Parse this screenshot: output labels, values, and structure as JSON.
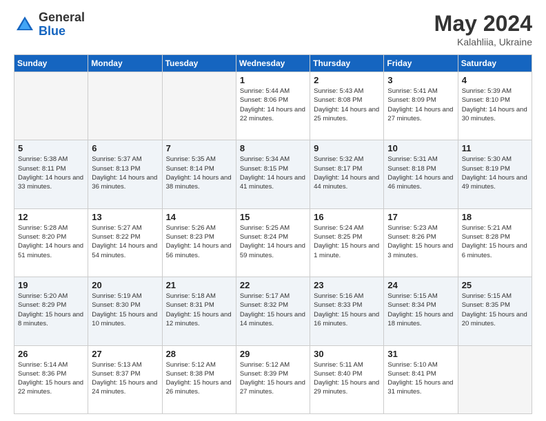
{
  "logo": {
    "general": "General",
    "blue": "Blue"
  },
  "title": {
    "month_year": "May 2024",
    "location": "Kalahliia, Ukraine"
  },
  "days_of_week": [
    "Sunday",
    "Monday",
    "Tuesday",
    "Wednesday",
    "Thursday",
    "Friday",
    "Saturday"
  ],
  "weeks": [
    [
      {
        "day": "",
        "sunrise": "",
        "sunset": "",
        "daylight": ""
      },
      {
        "day": "",
        "sunrise": "",
        "sunset": "",
        "daylight": ""
      },
      {
        "day": "",
        "sunrise": "",
        "sunset": "",
        "daylight": ""
      },
      {
        "day": "1",
        "sunrise": "Sunrise: 5:44 AM",
        "sunset": "Sunset: 8:06 PM",
        "daylight": "Daylight: 14 hours and 22 minutes."
      },
      {
        "day": "2",
        "sunrise": "Sunrise: 5:43 AM",
        "sunset": "Sunset: 8:08 PM",
        "daylight": "Daylight: 14 hours and 25 minutes."
      },
      {
        "day": "3",
        "sunrise": "Sunrise: 5:41 AM",
        "sunset": "Sunset: 8:09 PM",
        "daylight": "Daylight: 14 hours and 27 minutes."
      },
      {
        "day": "4",
        "sunrise": "Sunrise: 5:39 AM",
        "sunset": "Sunset: 8:10 PM",
        "daylight": "Daylight: 14 hours and 30 minutes."
      }
    ],
    [
      {
        "day": "5",
        "sunrise": "Sunrise: 5:38 AM",
        "sunset": "Sunset: 8:11 PM",
        "daylight": "Daylight: 14 hours and 33 minutes."
      },
      {
        "day": "6",
        "sunrise": "Sunrise: 5:37 AM",
        "sunset": "Sunset: 8:13 PM",
        "daylight": "Daylight: 14 hours and 36 minutes."
      },
      {
        "day": "7",
        "sunrise": "Sunrise: 5:35 AM",
        "sunset": "Sunset: 8:14 PM",
        "daylight": "Daylight: 14 hours and 38 minutes."
      },
      {
        "day": "8",
        "sunrise": "Sunrise: 5:34 AM",
        "sunset": "Sunset: 8:15 PM",
        "daylight": "Daylight: 14 hours and 41 minutes."
      },
      {
        "day": "9",
        "sunrise": "Sunrise: 5:32 AM",
        "sunset": "Sunset: 8:17 PM",
        "daylight": "Daylight: 14 hours and 44 minutes."
      },
      {
        "day": "10",
        "sunrise": "Sunrise: 5:31 AM",
        "sunset": "Sunset: 8:18 PM",
        "daylight": "Daylight: 14 hours and 46 minutes."
      },
      {
        "day": "11",
        "sunrise": "Sunrise: 5:30 AM",
        "sunset": "Sunset: 8:19 PM",
        "daylight": "Daylight: 14 hours and 49 minutes."
      }
    ],
    [
      {
        "day": "12",
        "sunrise": "Sunrise: 5:28 AM",
        "sunset": "Sunset: 8:20 PM",
        "daylight": "Daylight: 14 hours and 51 minutes."
      },
      {
        "day": "13",
        "sunrise": "Sunrise: 5:27 AM",
        "sunset": "Sunset: 8:22 PM",
        "daylight": "Daylight: 14 hours and 54 minutes."
      },
      {
        "day": "14",
        "sunrise": "Sunrise: 5:26 AM",
        "sunset": "Sunset: 8:23 PM",
        "daylight": "Daylight: 14 hours and 56 minutes."
      },
      {
        "day": "15",
        "sunrise": "Sunrise: 5:25 AM",
        "sunset": "Sunset: 8:24 PM",
        "daylight": "Daylight: 14 hours and 59 minutes."
      },
      {
        "day": "16",
        "sunrise": "Sunrise: 5:24 AM",
        "sunset": "Sunset: 8:25 PM",
        "daylight": "Daylight: 15 hours and 1 minute."
      },
      {
        "day": "17",
        "sunrise": "Sunrise: 5:23 AM",
        "sunset": "Sunset: 8:26 PM",
        "daylight": "Daylight: 15 hours and 3 minutes."
      },
      {
        "day": "18",
        "sunrise": "Sunrise: 5:21 AM",
        "sunset": "Sunset: 8:28 PM",
        "daylight": "Daylight: 15 hours and 6 minutes."
      }
    ],
    [
      {
        "day": "19",
        "sunrise": "Sunrise: 5:20 AM",
        "sunset": "Sunset: 8:29 PM",
        "daylight": "Daylight: 15 hours and 8 minutes."
      },
      {
        "day": "20",
        "sunrise": "Sunrise: 5:19 AM",
        "sunset": "Sunset: 8:30 PM",
        "daylight": "Daylight: 15 hours and 10 minutes."
      },
      {
        "day": "21",
        "sunrise": "Sunrise: 5:18 AM",
        "sunset": "Sunset: 8:31 PM",
        "daylight": "Daylight: 15 hours and 12 minutes."
      },
      {
        "day": "22",
        "sunrise": "Sunrise: 5:17 AM",
        "sunset": "Sunset: 8:32 PM",
        "daylight": "Daylight: 15 hours and 14 minutes."
      },
      {
        "day": "23",
        "sunrise": "Sunrise: 5:16 AM",
        "sunset": "Sunset: 8:33 PM",
        "daylight": "Daylight: 15 hours and 16 minutes."
      },
      {
        "day": "24",
        "sunrise": "Sunrise: 5:15 AM",
        "sunset": "Sunset: 8:34 PM",
        "daylight": "Daylight: 15 hours and 18 minutes."
      },
      {
        "day": "25",
        "sunrise": "Sunrise: 5:15 AM",
        "sunset": "Sunset: 8:35 PM",
        "daylight": "Daylight: 15 hours and 20 minutes."
      }
    ],
    [
      {
        "day": "26",
        "sunrise": "Sunrise: 5:14 AM",
        "sunset": "Sunset: 8:36 PM",
        "daylight": "Daylight: 15 hours and 22 minutes."
      },
      {
        "day": "27",
        "sunrise": "Sunrise: 5:13 AM",
        "sunset": "Sunset: 8:37 PM",
        "daylight": "Daylight: 15 hours and 24 minutes."
      },
      {
        "day": "28",
        "sunrise": "Sunrise: 5:12 AM",
        "sunset": "Sunset: 8:38 PM",
        "daylight": "Daylight: 15 hours and 26 minutes."
      },
      {
        "day": "29",
        "sunrise": "Sunrise: 5:12 AM",
        "sunset": "Sunset: 8:39 PM",
        "daylight": "Daylight: 15 hours and 27 minutes."
      },
      {
        "day": "30",
        "sunrise": "Sunrise: 5:11 AM",
        "sunset": "Sunset: 8:40 PM",
        "daylight": "Daylight: 15 hours and 29 minutes."
      },
      {
        "day": "31",
        "sunrise": "Sunrise: 5:10 AM",
        "sunset": "Sunset: 8:41 PM",
        "daylight": "Daylight: 15 hours and 31 minutes."
      },
      {
        "day": "",
        "sunrise": "",
        "sunset": "",
        "daylight": ""
      }
    ]
  ]
}
